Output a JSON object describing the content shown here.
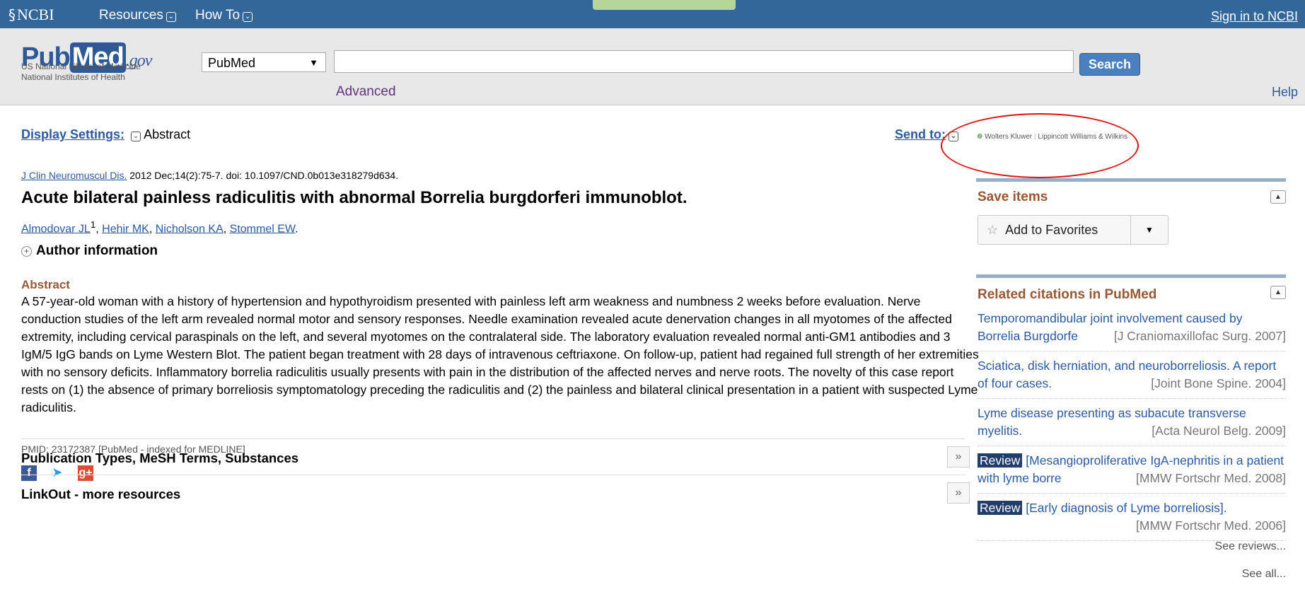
{
  "topbar": {
    "ncbi": "NCBI",
    "resources": "Resources",
    "howto": "How To",
    "signin": "Sign in to NCBI"
  },
  "search": {
    "logo_pub": "Pub",
    "logo_med": "Med",
    "logo_gov": ".gov",
    "sub1": "US National Library of Medicine",
    "sub2": "National Institutes of Health",
    "db": "PubMed",
    "query": "",
    "button": "Search",
    "advanced": "Advanced",
    "help": "Help"
  },
  "article": {
    "display_settings": "Display Settings:",
    "display_mode": "Abstract",
    "send_to": "Send to:",
    "journal": "J Clin Neuromuscul Dis.",
    "citation": "2012 Dec;14(2):75-7. doi: 10.1097/CND.0b013e318279d634.",
    "title": "Acute bilateral painless radiculitis with abnormal Borrelia burgdorferi immunoblot.",
    "authors": [
      "Almodovar JL",
      "Hehir MK",
      "Nicholson KA",
      "Stommel EW"
    ],
    "author_sup": "1",
    "author_info": "Author information",
    "abstract_head": "Abstract",
    "abstract": "A 57-year-old woman with a history of hypertension and hypothyroidism presented with painless left arm weakness and numbness 2 weeks before evaluation. Nerve conduction studies of the left arm revealed normal motor and sensory responses. Needle examination revealed acute denervation changes in all myotomes of the affected extremity, including cervical paraspinals on the left, and several myotomes on the contralateral side. The laboratory evaluation revealed normal anti-GM1 antibodies and 3 IgM/5 IgG bands on Lyme Western Blot. The patient began treatment with 28 days of intravenous ceftriaxone. On follow-up, patient had regained full strength of her extremities with no sensory deficits. Inflammatory borrelia radiculitis usually presents with pain in the distribution of the affected nerves and nerve roots. The novelty of this case report rests on (1) the absence of primary borreliosis symptomatology preceding the radiculitis and (2) the painless and bilateral clinical presentation in a patient with suspected Lyme radiculitis.",
    "pmid": "PMID: 23172387 [PubMed - indexed for MEDLINE]",
    "section1": "Publication Types, MeSH Terms, Substances",
    "section2": "LinkOut - more resources"
  },
  "sidebar": {
    "publisher_1": "Wolters Kluwer",
    "publisher_2": "Lippincott Williams & Wilkins",
    "save_head": "Save items",
    "add_fav": "Add to Favorites",
    "related_head": "Related citations in PubMed",
    "related": [
      {
        "title": "Temporomandibular joint involvement caused by Borrelia Burgdorfe",
        "src": "[J Craniomaxillofac Surg. 2007]",
        "review": ""
      },
      {
        "title": "Sciatica, disk herniation, and neuroborreliosis. A report of four cases.",
        "src": "[Joint Bone Spine. 2004]",
        "review": ""
      },
      {
        "title": "Lyme disease presenting as subacute transverse myelitis.",
        "src": "[Acta Neurol Belg. 2009]",
        "review": ""
      },
      {
        "title": "[Mesangioproliferative IgA-nephritis in a patient with lyme borre",
        "src": "[MMW Fortschr Med. 2008]",
        "review": "Review"
      },
      {
        "title": "[Early diagnosis of Lyme borreliosis].",
        "src": "[MMW Fortschr Med. 2006]",
        "review": "Review"
      }
    ],
    "see_reviews": "See reviews...",
    "see_all": "See all..."
  },
  "colors": {
    "topbar": "#336699",
    "section_head": "#985735",
    "link": "#2c5aa0",
    "annotation": "#e01010"
  }
}
